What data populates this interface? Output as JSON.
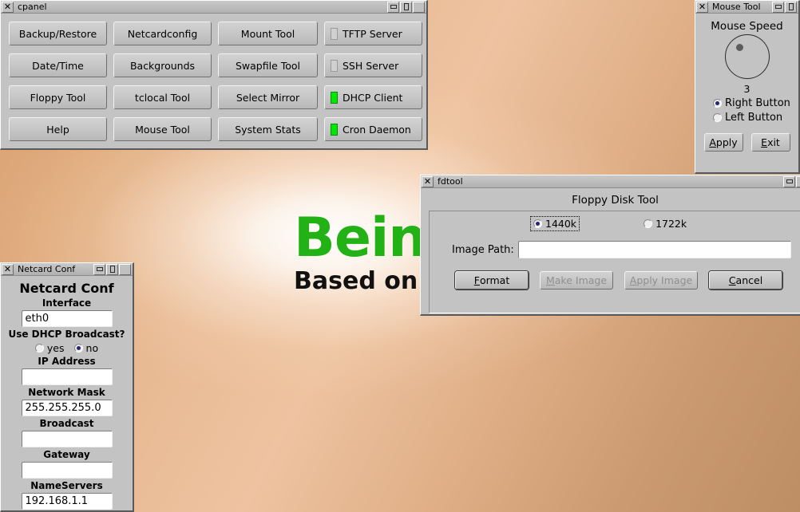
{
  "desktop": {
    "wallpaper_line1": "Bein",
    "wallpaper_line2": "Based on Ti",
    "accent_green": "#22b215",
    "background_tan": "#d7a173"
  },
  "cpanel": {
    "title": "cpanel",
    "close_glyph": "✕",
    "buttons": [
      {
        "label": "Backup/Restore"
      },
      {
        "label": "Netcardconfig"
      },
      {
        "label": "Mount Tool"
      },
      {
        "label": "TFTP Server",
        "led": "off"
      },
      {
        "label": "Date/Time"
      },
      {
        "label": "Backgrounds"
      },
      {
        "label": "Swapfile Tool"
      },
      {
        "label": "SSH Server",
        "led": "off"
      },
      {
        "label": "Floppy Tool"
      },
      {
        "label": "tclocal Tool"
      },
      {
        "label": "Select Mirror"
      },
      {
        "label": "DHCP Client",
        "led": "on"
      },
      {
        "label": "Help"
      },
      {
        "label": "Mouse Tool"
      },
      {
        "label": "System Stats"
      },
      {
        "label": "Cron Daemon",
        "led": "on"
      }
    ],
    "led_on_color": "#00e800",
    "led_off_color": "#d0d0d0"
  },
  "mouse_tool": {
    "title": "Mouse Tool",
    "close_glyph": "✕",
    "heading": "Mouse Speed",
    "speed_value": "3",
    "options": [
      {
        "label": "Right Button",
        "selected": true
      },
      {
        "label": "Left Button",
        "selected": false
      }
    ],
    "apply_label_prefix": "A",
    "apply_label_rest": "pply",
    "exit_label_prefix": "E",
    "exit_label_rest": "xit"
  },
  "fdtool": {
    "title": "fdtool",
    "close_glyph": "✕",
    "heading": "Floppy Disk Tool",
    "size_options": [
      {
        "label": "1440k",
        "selected": true,
        "focused": true
      },
      {
        "label": "1722k",
        "selected": false,
        "focused": false
      }
    ],
    "image_path_label": "Image Path:",
    "image_path_value": "",
    "buttons": [
      {
        "mnemonic": "F",
        "rest": "ormat",
        "enabled": true,
        "default": true
      },
      {
        "mnemonic": "M",
        "rest": "ake Image",
        "enabled": false,
        "default": false
      },
      {
        "mnemonic": "A",
        "rest": "pply Image",
        "enabled": false,
        "default": false
      },
      {
        "mnemonic": "C",
        "rest": "ancel",
        "enabled": true,
        "default": true
      }
    ]
  },
  "netcard": {
    "title": "Netcard Conf",
    "close_glyph": "✕",
    "heading": "Netcard Conf",
    "interface_label": "Interface",
    "interface_value": "eth0",
    "dhcp_question": "Use DHCP Broadcast?",
    "dhcp_options": [
      {
        "label": "yes",
        "selected": false
      },
      {
        "label": "no",
        "selected": true
      }
    ],
    "ip_label": "IP Address",
    "ip_value": "",
    "mask_label": "Network Mask",
    "mask_value": "255.255.255.0",
    "broadcast_label": "Broadcast",
    "broadcast_value": "",
    "gateway_label": "Gateway",
    "gateway_value": "",
    "nameservers_label": "NameServers",
    "nameservers_value": "192.168.1.1"
  }
}
